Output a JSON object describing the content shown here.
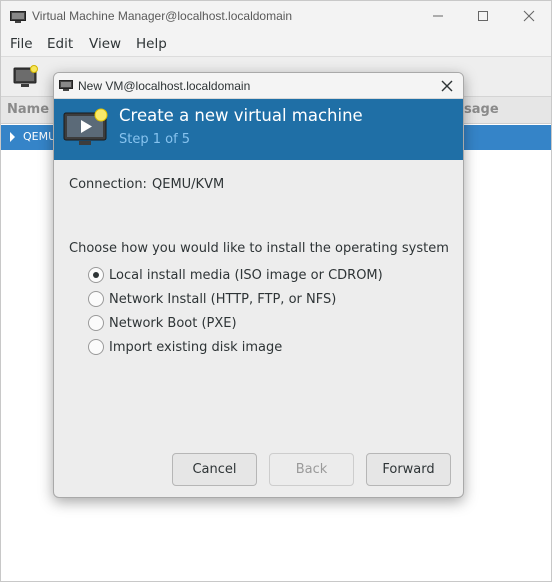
{
  "main_window": {
    "title": "Virtual Machine Manager@localhost.localdomain",
    "menu": [
      "File",
      "Edit",
      "View",
      "Help"
    ],
    "columns": {
      "name": "Name",
      "usage": "sage"
    },
    "vm_row": {
      "name": "QEMU"
    }
  },
  "dialog": {
    "title": "New VM@localhost.localdomain",
    "header": {
      "title": "Create a new virtual machine",
      "step": "Step 1 of 5"
    },
    "connection": {
      "label": "Connection:",
      "value": "QEMU/KVM"
    },
    "prompt": "Choose how you would like to install the operating system",
    "options": [
      {
        "label": "Local install media (ISO image or CDROM)",
        "checked": true
      },
      {
        "label": "Network Install (HTTP, FTP, or NFS)",
        "checked": false
      },
      {
        "label": "Network Boot (PXE)",
        "checked": false
      },
      {
        "label": "Import existing disk image",
        "checked": false
      }
    ],
    "buttons": {
      "cancel": "Cancel",
      "back": "Back",
      "forward": "Forward"
    }
  },
  "colors": {
    "header_bg": "#1f6fa6",
    "selection": "#3584c8",
    "step_text": "#87c3ef"
  }
}
